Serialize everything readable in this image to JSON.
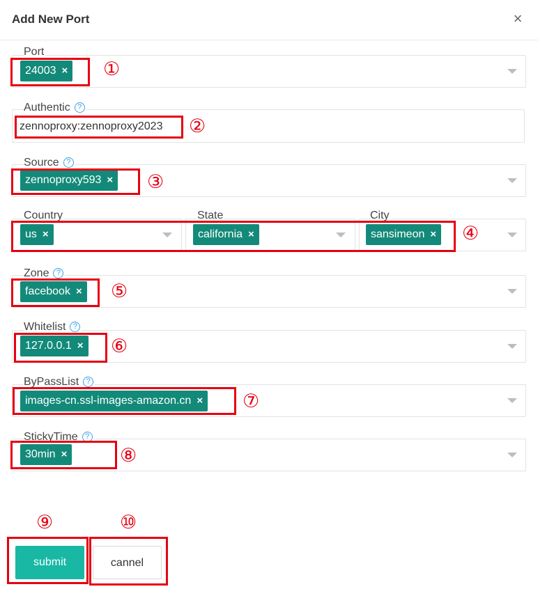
{
  "dialog": {
    "title": "Add New Port",
    "close_icon": "×"
  },
  "fields": {
    "port": {
      "label": "Port",
      "tag": "24003"
    },
    "authentic": {
      "label": "Authentic",
      "value": "zennoproxy:zennoproxy2023"
    },
    "source": {
      "label": "Source",
      "tag": "zennoproxy593"
    },
    "country": {
      "label": "Country",
      "tag": "us"
    },
    "state": {
      "label": "State",
      "tag": "california"
    },
    "city": {
      "label": "City",
      "tag": "sansimeon"
    },
    "zone": {
      "label": "Zone",
      "tag": "facebook"
    },
    "whitelist": {
      "label": "Whitelist",
      "tag": "127.0.0.1"
    },
    "bypasslist": {
      "label": "ByPassList",
      "tag": "images-cn.ssl-images-amazon.cn"
    },
    "stickytime": {
      "label": "StickyTime",
      "tag": "30min"
    }
  },
  "tag_remove": "×",
  "help_glyph": "?",
  "annotations": [
    "①",
    "②",
    "③",
    "④",
    "⑤",
    "⑥",
    "⑦",
    "⑧",
    "⑨",
    "⑩"
  ],
  "buttons": {
    "submit": "submit",
    "cancel": "cannel"
  },
  "colors": {
    "tag": "#138a79",
    "submit": "#18b8a5",
    "annotation": "#e60012",
    "help": "#3aa0e6"
  }
}
